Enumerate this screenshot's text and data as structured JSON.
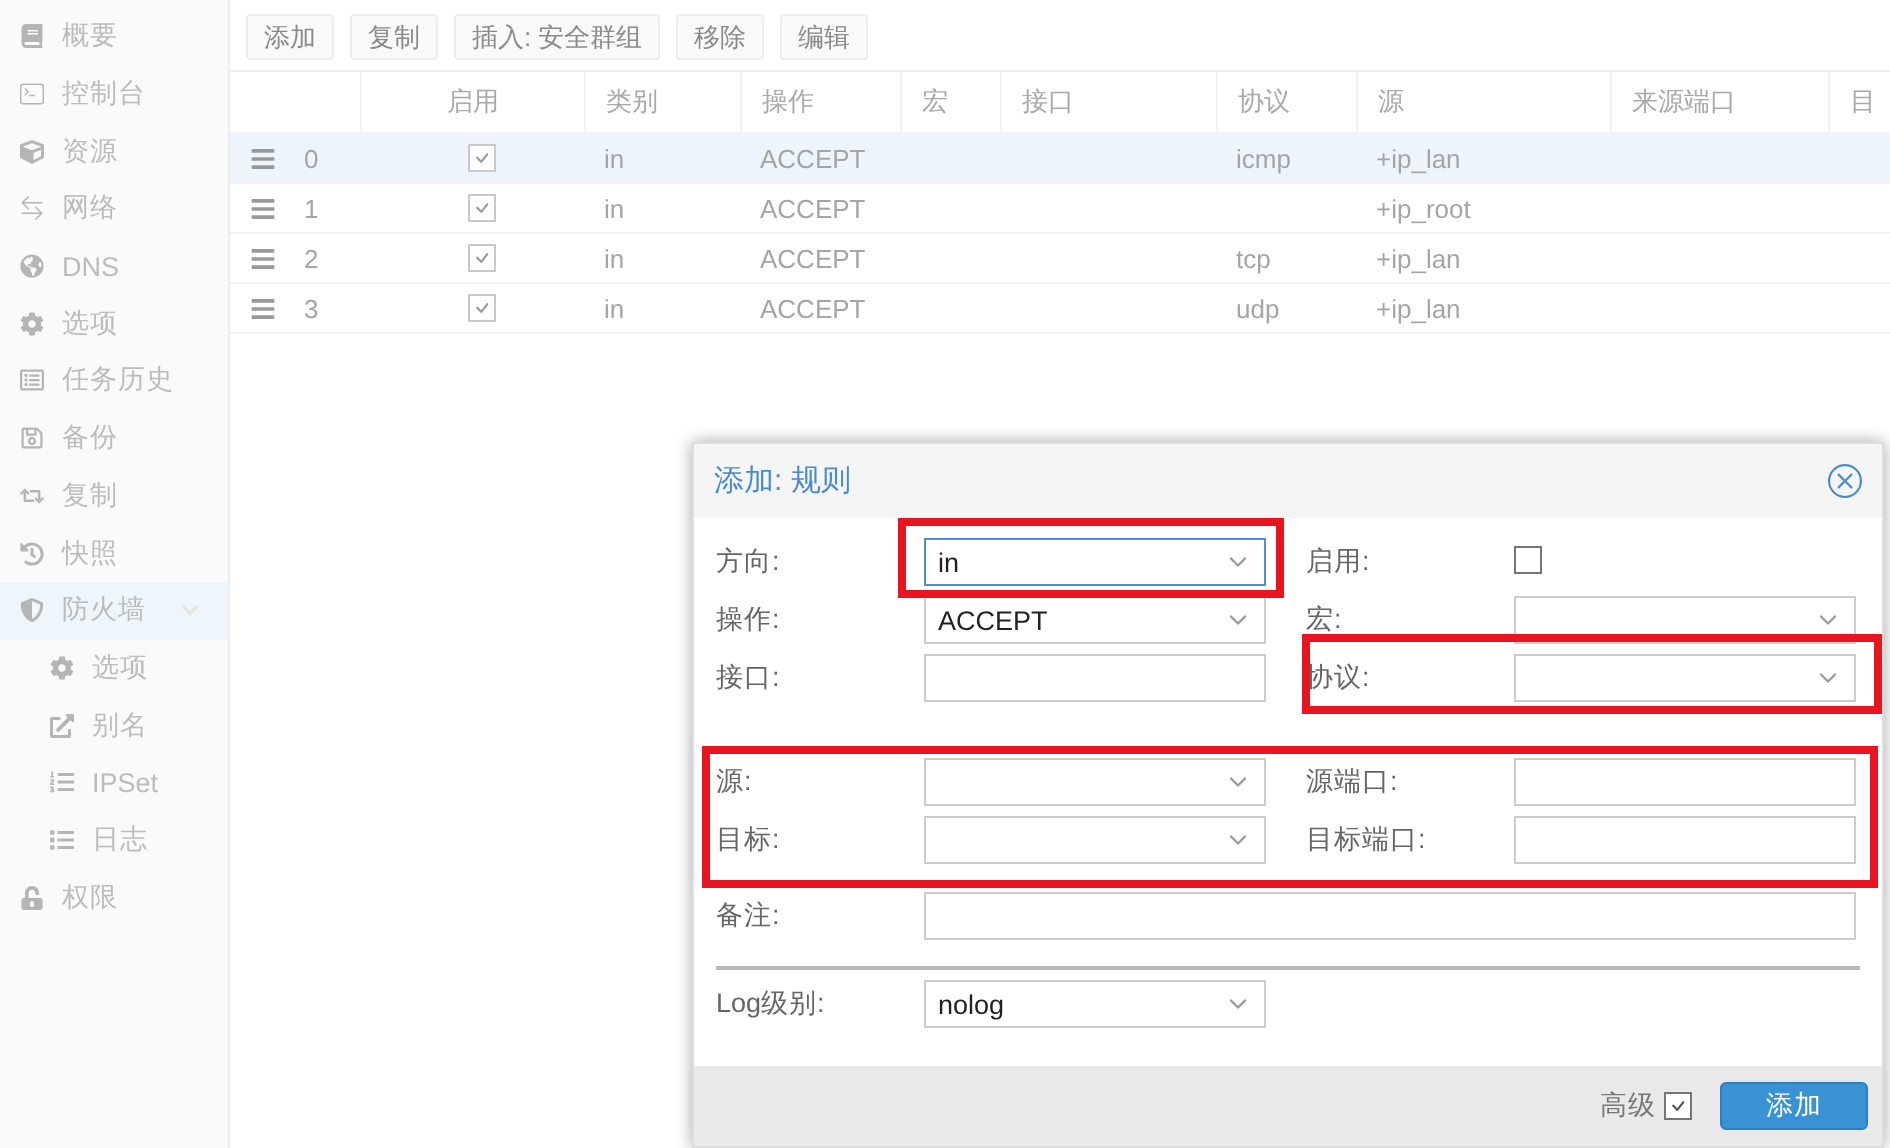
{
  "sidebar": {
    "items": [
      {
        "label": "概要",
        "selected": false
      },
      {
        "label": "控制台",
        "selected": false
      },
      {
        "label": "资源",
        "selected": false
      },
      {
        "label": "网络",
        "selected": false
      },
      {
        "label": "DNS",
        "selected": false
      },
      {
        "label": "选项",
        "selected": false
      },
      {
        "label": "任务历史",
        "selected": false
      },
      {
        "label": "备份",
        "selected": false
      },
      {
        "label": "复制",
        "selected": false
      },
      {
        "label": "快照",
        "selected": false
      },
      {
        "label": "防火墙",
        "selected": true,
        "expanded": true,
        "children": [
          {
            "label": "选项",
            "selected": false
          },
          {
            "label": "别名",
            "selected": false
          },
          {
            "label": "IPSet",
            "selected": false
          },
          {
            "label": "日志",
            "selected": false
          }
        ]
      },
      {
        "label": "权限",
        "selected": false
      }
    ]
  },
  "toolbar": {
    "buttons": [
      "添加",
      "复制",
      "插入: 安全群组",
      "移除",
      "编辑"
    ]
  },
  "table": {
    "columns": [
      "启用",
      "类别",
      "操作",
      "宏",
      "接口",
      "协议",
      "源",
      "来源端口",
      "目"
    ],
    "rows": [
      {
        "number": "0",
        "enabled": true,
        "type": "in",
        "action": "ACCEPT",
        "protocol": "icmp",
        "source": "+ip_lan",
        "selected": true
      },
      {
        "number": "1",
        "enabled": true,
        "type": "in",
        "action": "ACCEPT",
        "source": "+ip_root",
        "selected": false
      },
      {
        "number": "2",
        "enabled": true,
        "type": "in",
        "action": "ACCEPT",
        "protocol": "tcp",
        "source": "+ip_lan",
        "selected": false
      },
      {
        "number": "3",
        "enabled": true,
        "type": "in",
        "action": "ACCEPT",
        "protocol": "udp",
        "source": "+ip_lan",
        "selected": false
      }
    ]
  },
  "dialog": {
    "title": "添加: 规则",
    "sections": [
      {
        "kind": "fields",
        "rows": [
          {
            "left": {
              "label": "方向:",
              "kind": "select",
              "value": "in",
              "focused": true
            },
            "right": {
              "label": "启用:",
              "kind": "checkbox",
              "checked": false
            }
          },
          {
            "left": {
              "label": "操作:",
              "kind": "select",
              "value": "ACCEPT",
              "focused": false
            },
            "right": {
              "label": "宏:",
              "kind": "select",
              "focused": false
            }
          },
          {
            "left": {
              "label": "接口:",
              "kind": "text",
              "focused": false
            },
            "right": {
              "label": "协议:",
              "kind": "select",
              "focused": false
            }
          }
        ]
      },
      {
        "kind": "fields",
        "rows": [
          {
            "left": {
              "label": "源:",
              "kind": "select",
              "focused": false
            },
            "right": {
              "label": "源端口:",
              "kind": "text",
              "focused": false
            }
          },
          {
            "left": {
              "label": "目标:",
              "kind": "select",
              "focused": false
            },
            "right": {
              "label": "目标端口:",
              "kind": "text",
              "focused": false
            }
          }
        ]
      },
      {
        "kind": "fields",
        "rows": [
          {
            "wide": {
              "label": "备注:",
              "kind": "text",
              "focused": false
            }
          }
        ]
      },
      {
        "kind": "divider"
      },
      {
        "kind": "fields",
        "rows": [
          {
            "left": {
              "label": "Log级别:",
              "kind": "select",
              "value": "nolog",
              "focused": false
            }
          }
        ]
      }
    ],
    "footer": {
      "advanced": {
        "label": "高级",
        "checked": true
      },
      "submit": "添加"
    }
  }
}
